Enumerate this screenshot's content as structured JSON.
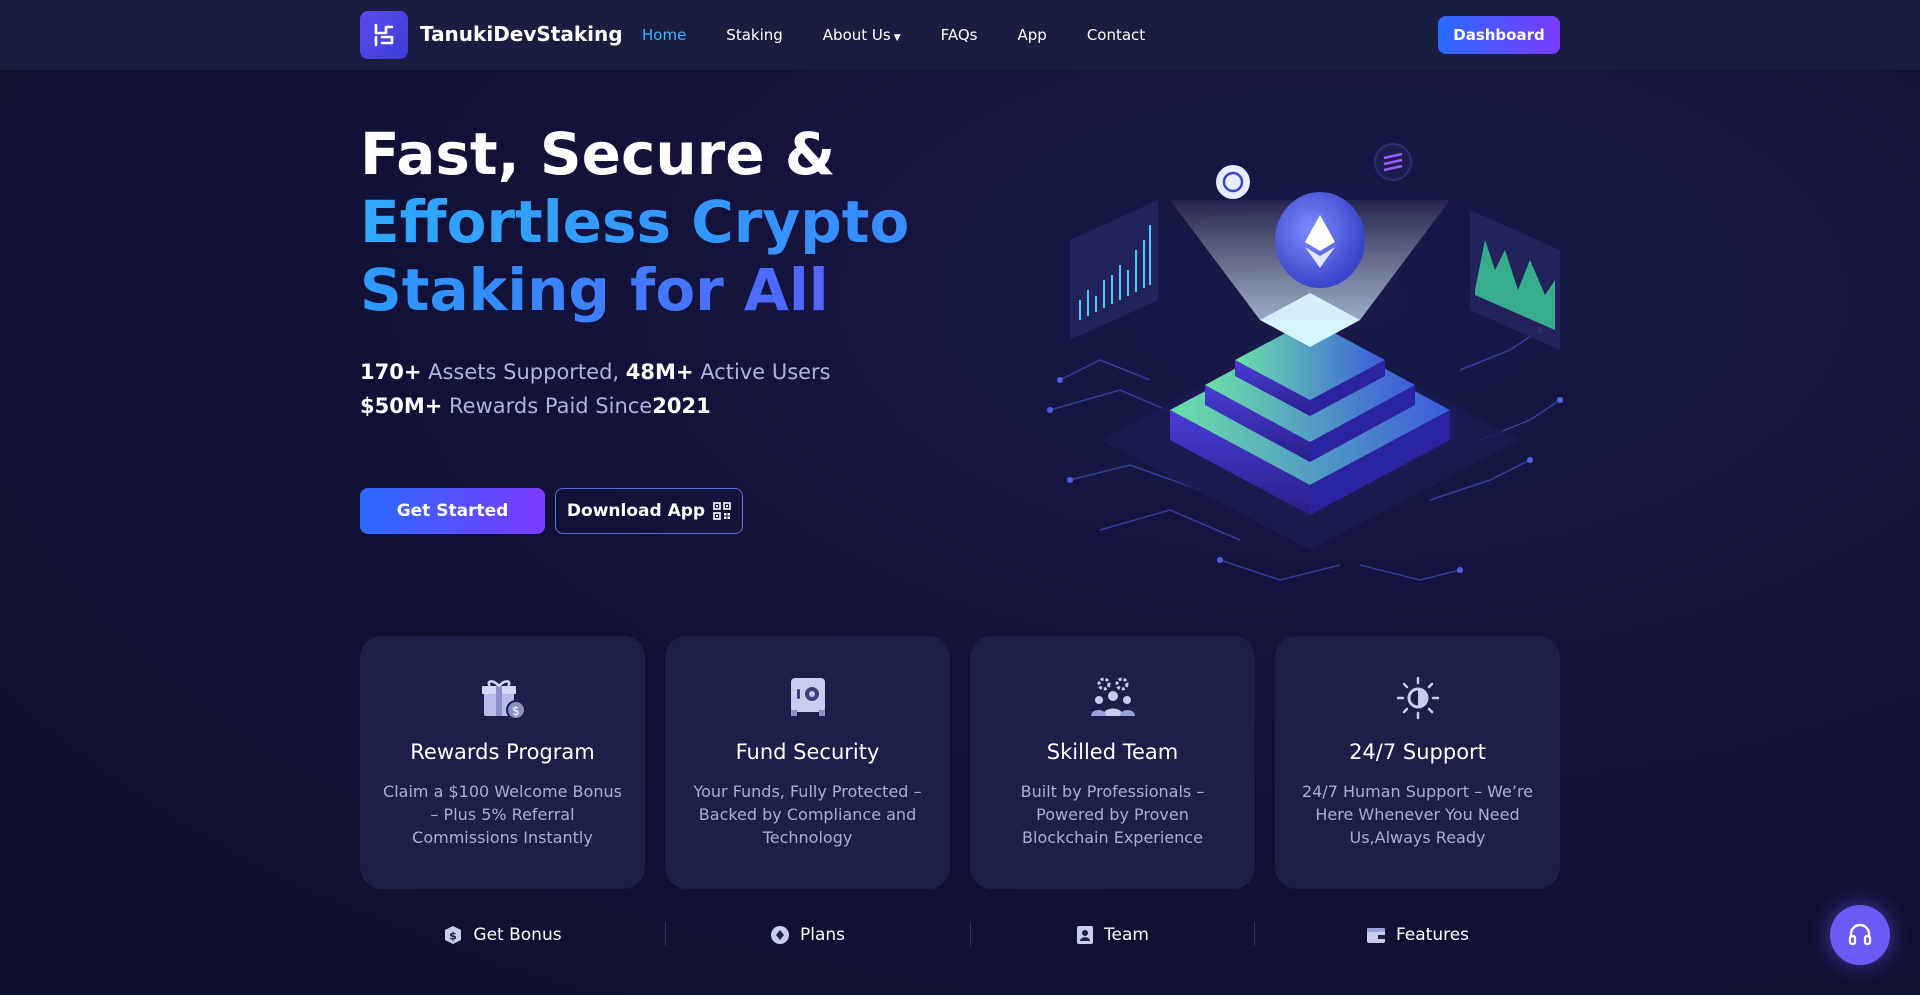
{
  "nav": {
    "brand": "TanukiDevStaking",
    "links": [
      {
        "label": "Home",
        "active": true
      },
      {
        "label": "Staking"
      },
      {
        "label": "About Us",
        "dropdown": true
      },
      {
        "label": "FAQs"
      },
      {
        "label": "App"
      },
      {
        "label": "Contact"
      }
    ],
    "dashboard_label": "Dashboard"
  },
  "hero": {
    "line1": "Fast, Secure &",
    "line2": "Effortless Crypto",
    "line3": "Staking for All",
    "stats1": {
      "a_val": "170+",
      "a_text": "Assets Supported,",
      "b_val": "48M+",
      "b_text": "Active Users"
    },
    "stats2": {
      "a_val": "$50M+",
      "a_text": "Rewards Paid Since",
      "b_val": "2021"
    },
    "get_started": "Get Started",
    "download_app": "Download App"
  },
  "cards": [
    {
      "icon": "gift-icon",
      "title": "Rewards Program",
      "desc": "Claim a $100 Welcome Bonus – Plus 5% Referral Commissions Instantly"
    },
    {
      "icon": "safe-icon",
      "title": "Fund Security",
      "desc": "Your Funds, Fully Protected – Backed by Compliance and Technology"
    },
    {
      "icon": "team-icon",
      "title": "Skilled Team",
      "desc": "Built by Professionals – Powered by Proven Blockchain Experience"
    },
    {
      "icon": "support-sun-icon",
      "title": "24/7 Support",
      "desc": "24/7 Human Support – We’re Here Whenever You Need Us,Always Ready"
    }
  ],
  "bottom_links": [
    {
      "icon": "dollar-shield-icon",
      "label": "Get Bonus"
    },
    {
      "icon": "plans-icon",
      "label": "Plans"
    },
    {
      "icon": "id-badge-icon",
      "label": "Team"
    },
    {
      "icon": "wallet-icon",
      "label": "Features"
    }
  ],
  "colors": {
    "accent": "#2a6bff",
    "accent2": "#7b3bff",
    "active_link": "#3bb4ff",
    "card_bg": "#1e1f48"
  }
}
